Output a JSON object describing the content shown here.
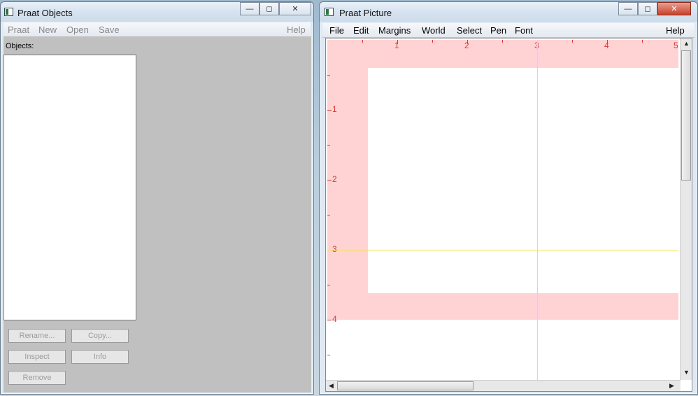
{
  "objects_window": {
    "title": "Praat Objects",
    "menu": [
      "Praat",
      "New",
      "Open",
      "Save"
    ],
    "help": "Help",
    "objects_label": "Objects:",
    "buttons": {
      "rename": "Rename...",
      "copy": "Copy...",
      "inspect": "Inspect",
      "info": "Info",
      "remove": "Remove"
    },
    "caption": {
      "minimize": "—",
      "maximize": "◻",
      "close": "✕"
    }
  },
  "picture_window": {
    "title": "Praat Picture",
    "menu": [
      "File",
      "Edit",
      "Margins",
      "World",
      "Select",
      "Pen",
      "Font"
    ],
    "help": "Help",
    "ruler_top": [
      "1",
      "2",
      "3",
      "4",
      "5"
    ],
    "ruler_left": [
      "1",
      "2",
      "3",
      "4"
    ],
    "caption": {
      "minimize": "—",
      "maximize": "◻",
      "close": "✕"
    },
    "colors": {
      "selection": "#ffd3d3",
      "ruler": "#d83a3a",
      "crosshair": "#f2e24a"
    }
  }
}
